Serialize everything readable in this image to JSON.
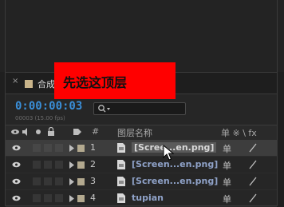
{
  "panel": {
    "tab_label": "合成",
    "timecode": "0:00:00:03",
    "timecode_sub": "00003 (15.00 fps)",
    "search_placeholder": ""
  },
  "columns": {
    "number": "#",
    "layer_name": "图层名称",
    "switches": "单 ※ \\ fx"
  },
  "layers": [
    {
      "index": "1",
      "name": "[Scree...en.png]",
      "selected": true,
      "label_color": "#b3a98f"
    },
    {
      "index": "2",
      "name": "[Screen...en.png]",
      "selected": false,
      "label_color": "#b3a98f"
    },
    {
      "index": "3",
      "name": "[Screen...en.png]",
      "selected": false,
      "label_color": "#b3a98f"
    },
    {
      "index": "4",
      "name": "tupian",
      "selected": false,
      "label_color": "#b3a98f"
    }
  ],
  "switch_glyph": "单",
  "annotation": {
    "text": "先选这顶层",
    "color": "#ff0000"
  },
  "colors": {
    "accent": "#3a8fd9",
    "background": "#262626"
  }
}
